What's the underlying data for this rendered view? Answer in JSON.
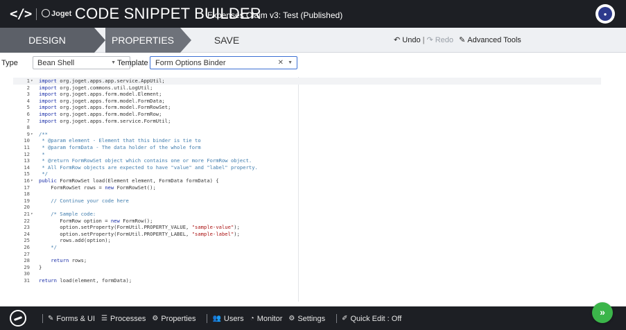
{
  "header": {
    "logo": "</>",
    "brand": "Joget",
    "title": "CODE SNIPPET BUILDER",
    "subtitle": "Expenses Claim v3: Test (Published)",
    "avatar_label": "admin"
  },
  "tabs": [
    {
      "label": "DESIGN",
      "active": true
    },
    {
      "label": "PROPERTIES",
      "active": false
    },
    {
      "label": "SAVE",
      "active": false
    }
  ],
  "toolbar": {
    "undo": "Undo",
    "redo": "Redo",
    "advanced": "Advanced Tools"
  },
  "controls": {
    "type_label": "Type",
    "type_value": "Bean Shell",
    "template_label": "Template",
    "template_value": "Form Options Binder"
  },
  "code_lines": [
    "import org.joget.apps.app.service.AppUtil;",
    "import org.joget.commons.util.LogUtil;",
    "import org.joget.apps.form.model.Element;",
    "import org.joget.apps.form.model.FormData;",
    "import org.joget.apps.form.model.FormRowSet;",
    "import org.joget.apps.form.model.FormRow;",
    "import org.joget.apps.form.service.FormUtil;",
    "",
    "/**",
    " * @param element - Element that this binder is tie to",
    " * @param formData - The data holder of the whole form",
    " *",
    " * @return FormRowSet object which contains one or more FormRow object.",
    " * All FormRow objects are expected to have \"value\" and \"label\" property.",
    " */",
    "public FormRowSet load(Element element, FormData formData) {",
    "    FormRowSet rows = new FormRowSet();",
    "",
    "    // Continue your code here",
    "",
    "    /* Sample code:",
    "       FormRow option = new FormRow();",
    "       option.setProperty(FormUtil.PROPERTY_VALUE, \"sample-value\");",
    "       option.setProperty(FormUtil.PROPERTY_LABEL, \"sample-label\");",
    "       rows.add(option);",
    "    */",
    "",
    "    return rows;",
    "}",
    "",
    "return load(element, formData);"
  ],
  "footer": {
    "items": [
      {
        "icon": "edit-icon",
        "label": "Forms & UI"
      },
      {
        "icon": "list-icon",
        "label": "Processes"
      },
      {
        "icon": "gear-icon",
        "label": "Properties"
      },
      {
        "icon": "users-icon",
        "label": "Users"
      },
      {
        "icon": "monitor-icon",
        "label": "Monitor"
      },
      {
        "icon": "cogs-icon",
        "label": "Settings"
      },
      {
        "icon": "pencil-icon",
        "label": "Quick Edit : Off"
      }
    ],
    "fab": "»"
  }
}
